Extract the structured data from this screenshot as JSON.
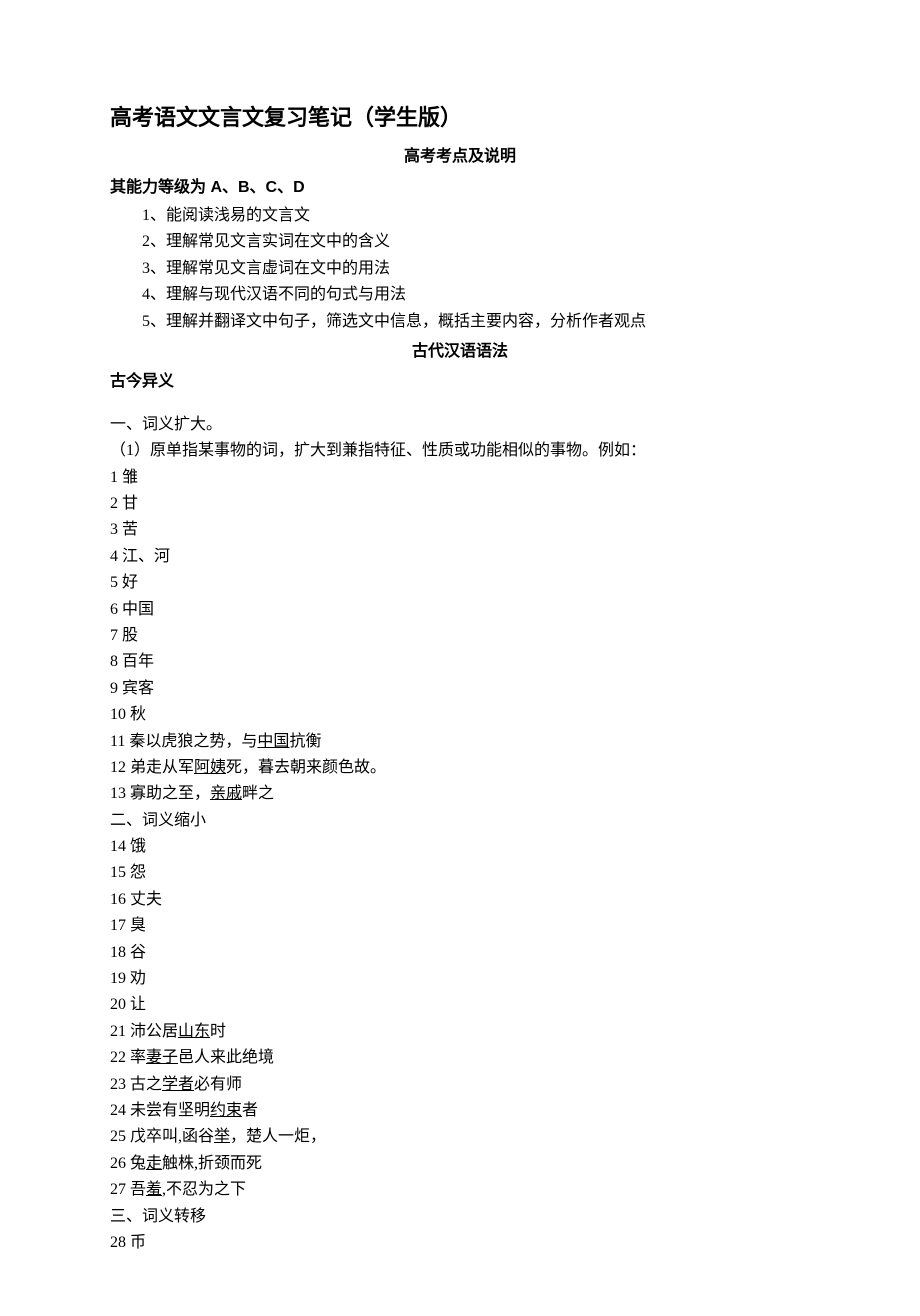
{
  "title": "高考语文文言文复习笔记（学生版）",
  "subtitle": "高考考点及说明",
  "ability_line": "其能力等级为 A、B、C、D",
  "points": [
    "1、能阅读浅易的文言文",
    "2、理解常见文言实词在文中的含义",
    "3、理解常见文言虚词在文中的用法",
    "4、理解与现代汉语不同的句式与用法",
    "5、理解并翻译文中句子，筛选文中信息，概括主要内容，分析作者观点"
  ],
  "grammar_heading": "古代汉语语法",
  "gujin_heading": "古今异义",
  "sec1_heading": "一、词义扩大。",
  "sec1_note": "（1）原单指某事物的词，扩大到兼指特征、性质或功能相似的事物。例如：",
  "sec1_items": {
    "i1": "1 雏",
    "i2": "2 甘",
    "i3": "3 苦",
    "i4": "4 江、河",
    "i5": "5 好",
    "i6": "6 中国",
    "i7": "7 股",
    "i8": "8 百年",
    "i9": "9 宾客",
    "i10": "10 秋",
    "i11a": "11 秦以虎狼之势，与",
    "i11u": "中国",
    "i11b": "抗衡",
    "i12a": "12 弟走从军",
    "i12u": "阿姨",
    "i12b": "死，暮去朝来颜色故。",
    "i13a": "13 寡助之至，",
    "i13u": "亲戚",
    "i13b": "畔之"
  },
  "sec2_heading": "二、词义缩小",
  "sec2_items": {
    "i14": "14 饿",
    "i15": "15 怨",
    "i16": "16 丈夫",
    "i17": "17 臭",
    "i18": "18 谷",
    "i19": "19 劝",
    "i20": "20 让",
    "i21a": "21 沛公居",
    "i21u": "山东",
    "i21b": "时",
    "i22a": "22 率",
    "i22u": "妻子",
    "i22b": "邑人来此绝境",
    "i23a": "23 古之",
    "i23u": "学者",
    "i23b": "必有师",
    "i24a": "24 未尝有坚明",
    "i24u": "约束",
    "i24b": "者",
    "i25a": "25 戊卒叫,函谷",
    "i25u": "举",
    "i25b": "，楚人一炬，",
    "i26a": "26 兔",
    "i26u": "走",
    "i26b": "触株,折颈而死",
    "i27a": "27 吾",
    "i27u": "羞",
    "i27b": ",不忍为之下"
  },
  "sec3_heading": "三、词义转移",
  "sec3_items": {
    "i28": "28 币"
  }
}
